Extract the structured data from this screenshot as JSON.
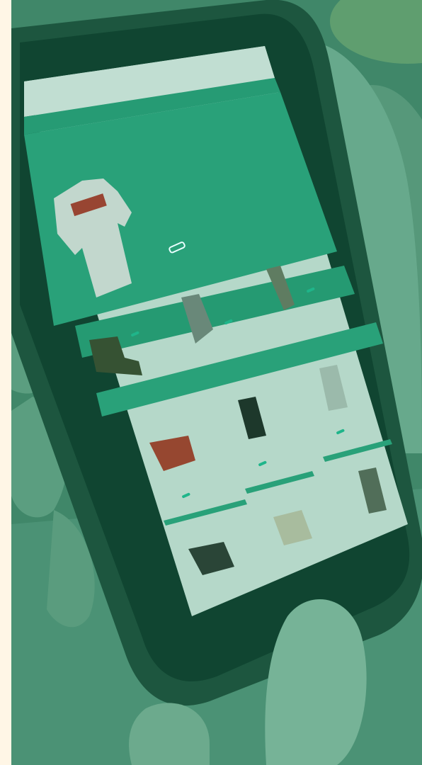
{
  "phone": {
    "screen": {
      "header": {
        "logo_label": "",
        "cart_label": ""
      },
      "nav": {
        "menu_text": ""
      },
      "hero": {
        "title": "",
        "description": "",
        "cta_label": ""
      },
      "section_label": "",
      "product_tiles": [],
      "grid_products": [],
      "colors": {
        "screen_bg": "#2eaa83",
        "accent": "#1fb58a",
        "tile_bg": "#d8ede4"
      }
    }
  }
}
